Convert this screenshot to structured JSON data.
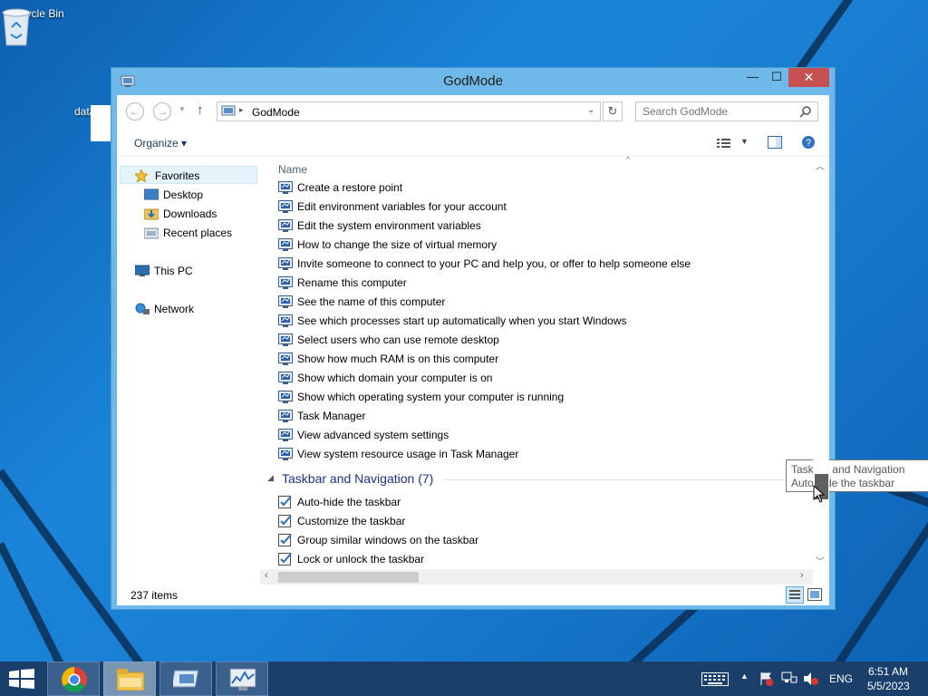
{
  "desktop": {
    "icons": [
      {
        "label": "Recycle Bin"
      },
      {
        "label": "data.ur"
      }
    ]
  },
  "window": {
    "title": "GodMode",
    "buttons": {
      "minimize": "—",
      "maximize": "☐",
      "close": "✕"
    }
  },
  "addressbar": {
    "path": "GodMode",
    "search_placeholder": "Search GodMode"
  },
  "commandbar": {
    "organize_label": "Organize ▾"
  },
  "navpane": {
    "favorites": "Favorites",
    "desktop": "Desktop",
    "downloads": "Downloads",
    "recent": "Recent places",
    "thispc": "This PC",
    "network": "Network"
  },
  "content": {
    "column_name": "Name",
    "system_items": [
      "Create a restore point",
      "Edit environment variables for your account",
      "Edit the system environment variables",
      "How to change the size of virtual memory",
      "Invite someone to connect to your PC and help you, or offer to help someone else",
      "Rename this computer",
      "See the name of this computer",
      "See which processes start up automatically when you start Windows",
      "Select users who can use remote desktop",
      "Show how much RAM is on this computer",
      "Show which domain your computer is on",
      "Show which operating system your computer is running",
      "Task Manager",
      "View advanced system settings",
      "View system resource usage in Task Manager"
    ],
    "group_title": "Taskbar and Navigation (7)",
    "taskbar_items": [
      "Auto-hide the taskbar",
      "Customize the taskbar",
      "Group similar windows on the taskbar",
      "Lock or unlock the taskbar"
    ],
    "tooltip": {
      "line1": "Taskbar and Navigation",
      "line2": "Auto-hide the taskbar"
    }
  },
  "statusbar": {
    "count": "237 items"
  },
  "tray": {
    "language": "ENG",
    "time": "6:51 AM",
    "date": "5/5/2023"
  },
  "colors": {
    "accent": "#6fb9ea",
    "close": "#c75050",
    "group_title": "#1e3287",
    "taskbar": "#1a3f6b"
  }
}
